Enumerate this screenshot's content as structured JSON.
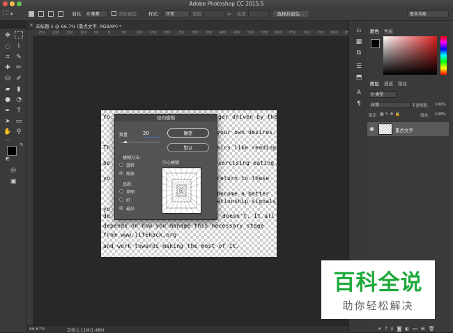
{
  "app": {
    "title": "Adobe Photoshop CC 2015.5"
  },
  "options": {
    "feather_label": "羽化:",
    "feather_value": "0 像素",
    "antialias_label": "消除锯齿",
    "style_label": "样式:",
    "style_value": "正常",
    "width_label": "宽度:",
    "height_label": "高度:",
    "select_mask_button": "选择并遮住...",
    "workspace": "基本功能"
  },
  "document": {
    "tab_label": "未标题-1 @ 66.7% (重点文字, RGB/8*) *",
    "close_glyph": "×",
    "zoom": "66.67%",
    "doc_size": "文档:1.11M/1.48M"
  },
  "ruler": {
    "ticks": [
      "250",
      "200",
      "150",
      "100",
      "50",
      "0",
      "50",
      "100",
      "150",
      "200",
      "250",
      "300",
      "350",
      "400",
      "450",
      "500",
      "550",
      "600",
      "650",
      "700",
      "750",
      "800",
      "850"
    ]
  },
  "image_text": [
    "Yo",
    "ger driven by the",
    "Th",
    "your own desires.",
    "be",
    "sics like reading",
    "yo",
    "exercising eating",
    "return to these",
    "become a better",
    "ationship signals",
    "yo",
    "de",
    "t doesn't. It all",
    "depends on how you manage this necessary stage",
    "from www.lifehack.org",
    "and work towards making the most of it."
  ],
  "dialog": {
    "title": "径向模糊",
    "amount_label": "数量",
    "amount_value": "20",
    "ok_button": "确定",
    "reset_button": "默认",
    "method_label": "模糊方法:",
    "method_options": [
      "旋转",
      "缩放"
    ],
    "method_selected": 1,
    "quality_label": "品质:",
    "quality_options": [
      "草图",
      "好",
      "最好"
    ],
    "quality_selected": 2,
    "center_label": "中心模糊"
  },
  "panels": {
    "color_tabs": [
      "颜色",
      "色板"
    ],
    "layer_tabs": [
      "图层",
      "通道",
      "路径"
    ],
    "filter_type": "类型",
    "blend_mode": "正常",
    "opacity_label": "不透明度:",
    "opacity_value": "100%",
    "lock_label": "锁定:",
    "fill_label": "填充:",
    "fill_value": "100%",
    "layer_name": "重点文字",
    "footer_icons": [
      "link",
      "fx",
      "mask",
      "adjust",
      "folder",
      "new",
      "trash"
    ]
  },
  "colors": {
    "foreground": "#000000",
    "background": "#ffffff",
    "accent": "#1faa3c"
  },
  "watermark": {
    "line1": "百科全说",
    "line2": "助你轻松解决"
  }
}
